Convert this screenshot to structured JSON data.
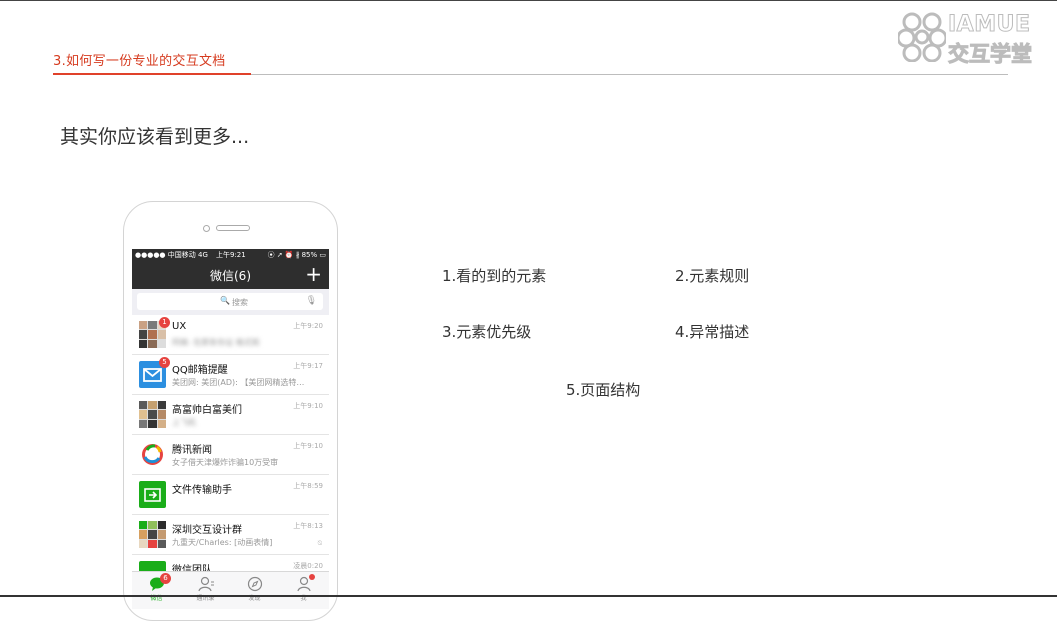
{
  "header": {
    "section_title": "3.如何写一份专业的交互文档",
    "logo_en": "IAMUE",
    "logo_cn": "交互学堂"
  },
  "subtitle": "其实你应该看到更多...",
  "phone": {
    "status": {
      "carrier": "●●●●● 中国移动  4G",
      "time": "上午9:21",
      "battery": "⦿ ➚ ⏰ ∦ 85% ▭"
    },
    "nav_title": "微信(6)",
    "search_placeholder": "搜索",
    "chats": [
      {
        "name": "UX",
        "msg": "阿峰: 在那条你证 格式和",
        "time": "上午9:20",
        "badge": "1"
      },
      {
        "name": "QQ邮箱提醒",
        "msg": "美团网: 美团(AD): 【美团网精选特…",
        "time": "上午9:17",
        "badge": "5"
      },
      {
        "name": "高富帅白富美们",
        "msg": "上飞机",
        "time": "上午9:10"
      },
      {
        "name": "腾讯新闻",
        "msg": "女子借天津爆炸诈骗10万受审",
        "time": "上午9:10"
      },
      {
        "name": "文件传输助手",
        "msg": "",
        "time": "上午8:59"
      },
      {
        "name": "深圳交互设计群",
        "msg": "九重天/Charles: [动画表情]",
        "time": "上午8:13",
        "mute": "⍉"
      },
      {
        "name": "微信团队",
        "msg": "",
        "time": "凌晨0:20"
      }
    ],
    "tabs": [
      {
        "label": "微信",
        "badge": "6"
      },
      {
        "label": "通讯录"
      },
      {
        "label": "发现"
      },
      {
        "label": "我"
      }
    ]
  },
  "items": {
    "i1": "1.看的到的元素",
    "i2": "2.元素规则",
    "i3": "3.元素优先级",
    "i4": "4.异常描述",
    "i5": "5.页面结构"
  }
}
